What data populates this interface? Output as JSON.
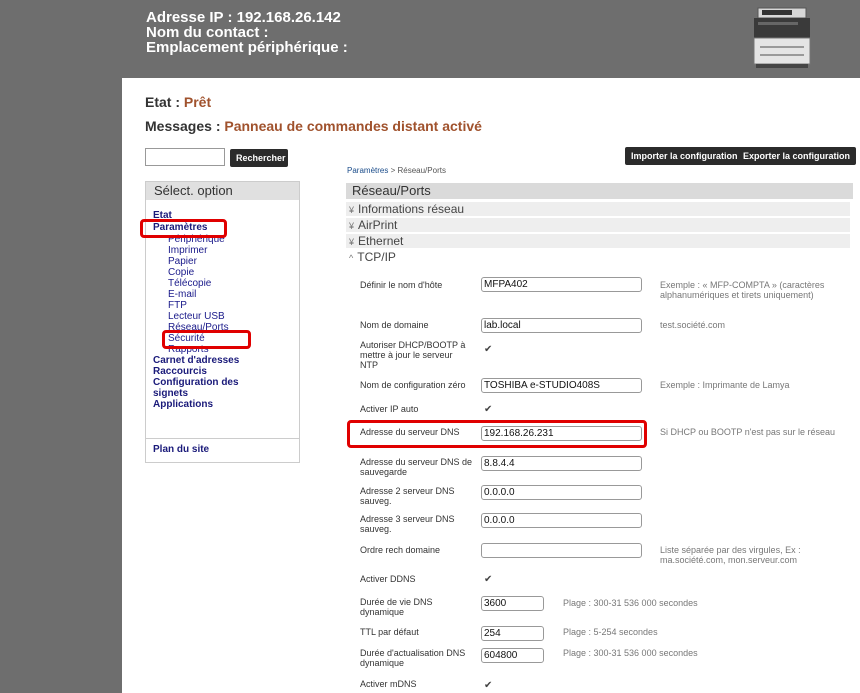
{
  "header": {
    "ip": "Adresse IP : 192.168.26.142",
    "contact": "Nom du contact :",
    "location": "Emplacement périphérique :"
  },
  "status": {
    "etat_label": "Etat : ",
    "etat_value": "Prêt",
    "messages_label": "Messages : ",
    "messages_value": "Panneau de commandes distant activé"
  },
  "search": {
    "value": "",
    "button_label": "Rechercher"
  },
  "toolbar": {
    "import_label": "Importer la configuration",
    "export_label": "Exporter la configuration"
  },
  "breadcrumb": {
    "root": "Paramètres",
    "sep": " > ",
    "current": "Réseau/Ports"
  },
  "sidebar": {
    "title": "Sélect. option",
    "etat": "Etat",
    "parametres": "Paramètres",
    "sub_items": [
      "Périphérique",
      "Imprimer",
      "Papier",
      "Copie",
      "Télécopie",
      "E-mail",
      "FTP",
      "Lecteur USB",
      "Réseau/Ports",
      "Sécurité",
      "Rapports"
    ],
    "bottom_items": [
      "Carnet d'adresses",
      "Raccourcis",
      "Configuration des",
      "signets",
      "Applications"
    ],
    "sitemap": "Plan du site"
  },
  "main": {
    "title": "Réseau/Ports",
    "sections": [
      "Informations réseau",
      "AirPrint",
      "Ethernet",
      "TCP/IP"
    ],
    "fields": {
      "hostname_label": "Définir le nom d'hôte",
      "hostname_value": "MFPA402",
      "hostname_hint": "Exemple : « MFP-COMPTA » (caractères alphanumériques et tirets uniquement)",
      "domain_label": "Nom de domaine",
      "domain_value": "lab.local",
      "domain_hint": "test.société.com",
      "dhcp_label": "Autoriser DHCP/BOOTP à mettre à jour le serveur NTP",
      "zeroconf_label": "Nom de configuration zéro",
      "zeroconf_value": "TOSHIBA e-STUDIO408S",
      "zeroconf_hint": "Exemple : Imprimante de Lamya",
      "autoip_label": "Activer IP auto",
      "dns_label": "Adresse du serveur DNS",
      "dns_value": "192.168.26.231",
      "dns_hint": "Si DHCP ou BOOTP n'est pas sur le réseau",
      "dns_backup_label": "Adresse du serveur DNS de sauvegarde",
      "dns_backup_value": "8.8.4.4",
      "dns2_label": "Adresse 2 serveur DNS sauveg.",
      "dns2_value": "0.0.0.0",
      "dns3_label": "Adresse 3 serveur DNS sauveg.",
      "dns3_value": "0.0.0.0",
      "search_order_label": "Ordre rech domaine",
      "search_order_value": "",
      "search_order_hint": "Liste séparée par des virgules, Ex : ma.société.com, mon.serveur.com",
      "ddns_label": "Activer DDNS",
      "dns_ttl_label": "Durée de vie DNS dynamique",
      "dns_ttl_value": "3600",
      "dns_ttl_range": "Plage : 300-31 536 000 secondes",
      "ttl_label": "TTL par défaut",
      "ttl_value": "254",
      "ttl_range": "Plage : 5-254 secondes",
      "refresh_label": "Durée d'actualisation DNS dynamique",
      "refresh_value": "604800",
      "refresh_range": "Plage : 300-31 536 000 secondes",
      "mdns_label": "Activer mDNS"
    },
    "checkmark": "✔"
  },
  "colors": {
    "highlight": "#e00000",
    "status_value": "#a0522d",
    "chrome": "#6e6e6e"
  }
}
